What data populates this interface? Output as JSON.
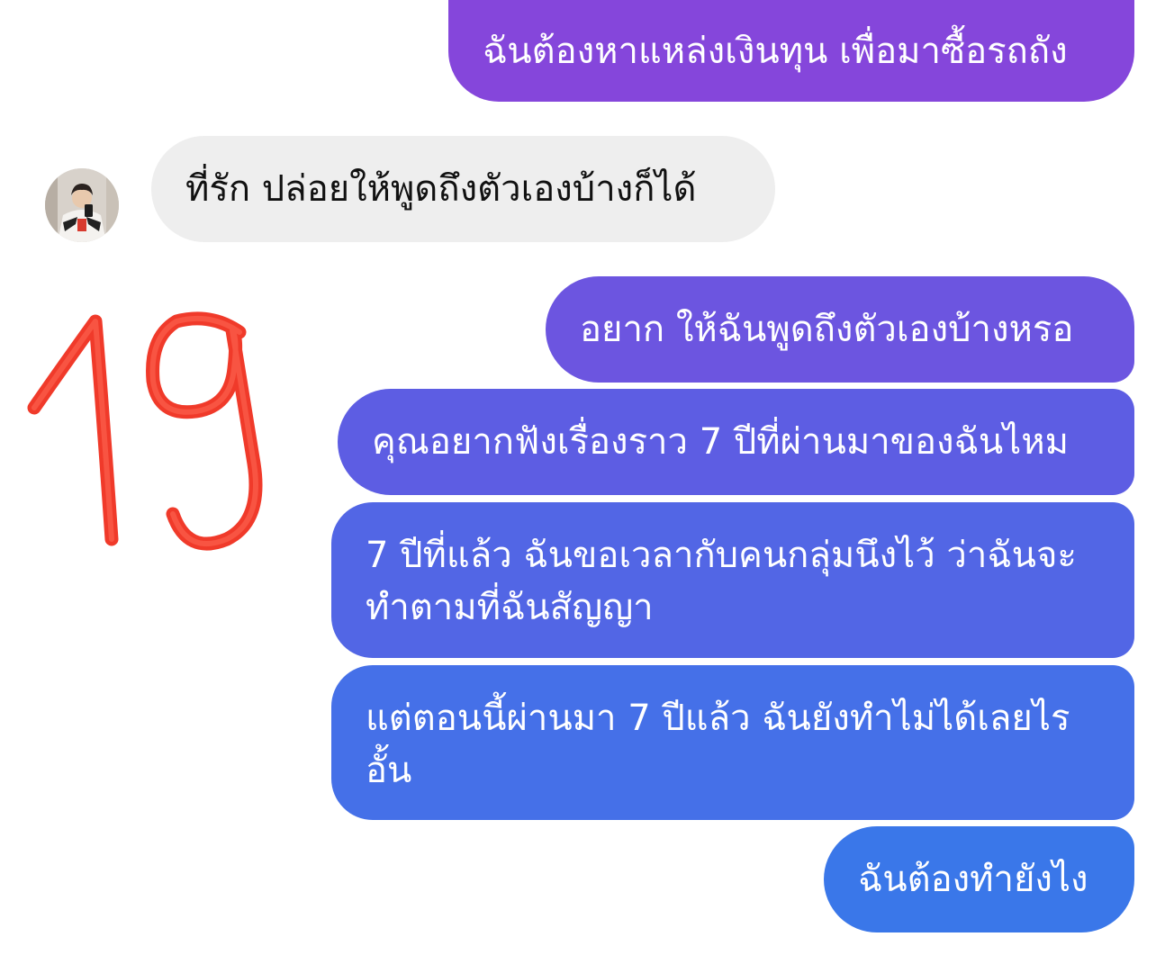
{
  "colors": {
    "bubble_top": "#8a44dc",
    "bubble_bottom": "#3b77e9",
    "incoming_bubble": "#eeeeee",
    "doodle_red": "#f03a2a"
  },
  "conversation": {
    "messages": [
      {
        "sender": "me",
        "text": "ฉันต้องหาแหล่งเงินทุน เพื่อมาซื้อรถถัง"
      },
      {
        "sender": "contact",
        "text": "ที่รัก ปล่อยให้พูดถึงตัวเองบ้างก็ได้"
      },
      {
        "sender": "me",
        "text": "อยาก ให้ฉันพูดถึงตัวเองบ้างหรอ"
      },
      {
        "sender": "me",
        "text": "คุณอยากฟังเรื่องราว 7 ปีที่ผ่านมาของฉันไหม"
      },
      {
        "sender": "me",
        "text": "7 ปีที่แล้ว ฉันขอเวลากับคนกลุ่มนึงไว้ ว่าฉันจะทำตามที่ฉันสัญญา"
      },
      {
        "sender": "me",
        "text": "แต่ตอนนี้ผ่านมา 7 ปีแล้ว ฉันยังทำไม่ได้เลยไรอั้น"
      },
      {
        "sender": "me",
        "text": "ฉันต้องทำยังไง"
      }
    ]
  },
  "contact": {
    "avatar_icon": "profile-photo"
  },
  "annotation": {
    "text": "19"
  }
}
